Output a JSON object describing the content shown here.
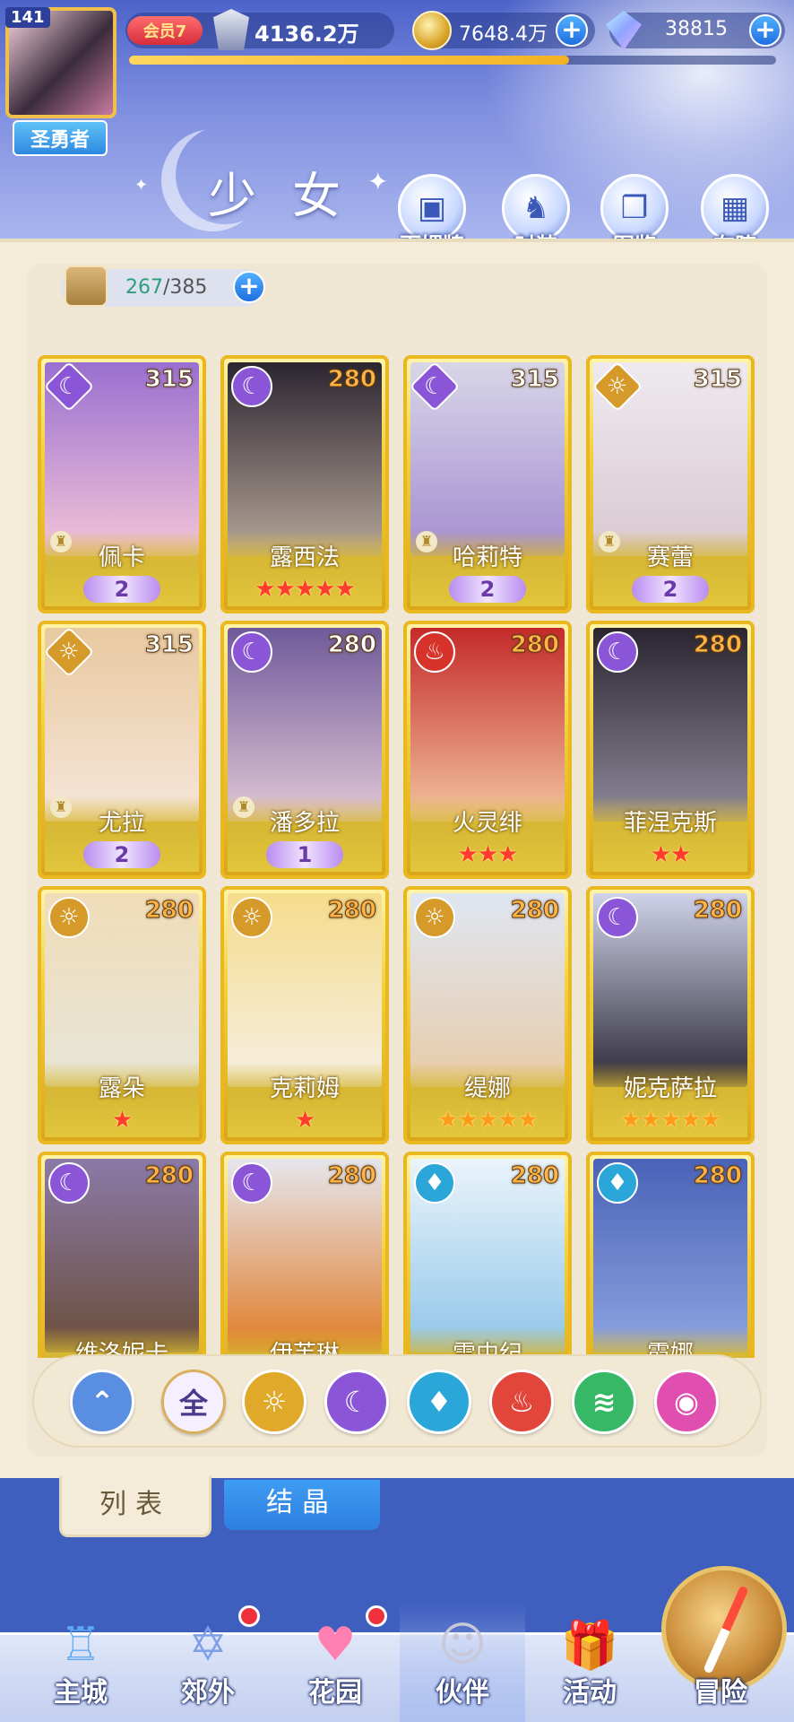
{
  "player": {
    "level": "141",
    "title": "圣勇者",
    "vip": "会员7",
    "power": "4136.2万",
    "gold": "7648.4万",
    "gems": "38815",
    "exp_fraction": 0.68
  },
  "header": {
    "page_title": "少女",
    "menu": [
      {
        "label": "百媚牌",
        "icon": "card-deck-icon"
      },
      {
        "label": "时装",
        "icon": "outfit-icon"
      },
      {
        "label": "图鉴",
        "icon": "book-icon"
      },
      {
        "label": "布阵",
        "icon": "formation-grid-icon"
      }
    ]
  },
  "collection": {
    "current": "267",
    "separator": "/",
    "total": "385"
  },
  "cards": [
    {
      "name": "佩卡",
      "level": "315",
      "element": "moon",
      "frame": "diamond",
      "awaken": "2",
      "stars": 0,
      "level_color": "white",
      "colors": [
        "#9a6fd0",
        "#f4c6d8"
      ]
    },
    {
      "name": "露西法",
      "level": "280",
      "element": "moon",
      "frame": "circle",
      "awaken": "",
      "stars": 5,
      "level_color": "orange",
      "colors": [
        "#2b2530",
        "#b7a79a"
      ]
    },
    {
      "name": "哈莉特",
      "level": "315",
      "element": "moon",
      "frame": "diamond",
      "awaken": "2",
      "stars": 0,
      "level_color": "white",
      "colors": [
        "#d8d6e8",
        "#a38cd0"
      ]
    },
    {
      "name": "赛蕾",
      "level": "315",
      "element": "sun",
      "frame": "diamond",
      "awaken": "2",
      "stars": 0,
      "level_color": "white",
      "colors": [
        "#eeeaf0",
        "#d9c8d0"
      ]
    },
    {
      "name": "尤拉",
      "level": "315",
      "element": "sun",
      "frame": "diamond",
      "awaken": "2",
      "stars": 0,
      "level_color": "white",
      "colors": [
        "#e8c9a0",
        "#f6e6da"
      ]
    },
    {
      "name": "潘多拉",
      "level": "280",
      "element": "moon",
      "frame": "circle",
      "awaken": "1",
      "stars": 0,
      "level_color": "white",
      "colors": [
        "#6f5a9a",
        "#e3c9d7"
      ]
    },
    {
      "name": "火灵绯",
      "level": "280",
      "element": "fire",
      "frame": "circle",
      "awaken": "",
      "stars": 3,
      "level_color": "orange",
      "colors": [
        "#c42a2a",
        "#f2c6a0"
      ]
    },
    {
      "name": "菲涅克斯",
      "level": "280",
      "element": "moon",
      "frame": "circle",
      "awaken": "",
      "stars": 2,
      "level_color": "orange",
      "colors": [
        "#2a2530",
        "#8f8a9a"
      ]
    },
    {
      "name": "露朵",
      "level": "280",
      "element": "sun",
      "frame": "circle",
      "awaken": "",
      "stars": 1,
      "level_color": "orange",
      "colors": [
        "#f1dcb8",
        "#e6e6d8"
      ]
    },
    {
      "name": "克莉姆",
      "level": "280",
      "element": "sun",
      "frame": "circle",
      "awaken": "",
      "stars": 1,
      "level_color": "orange",
      "colors": [
        "#f5dc8c",
        "#f6efe4"
      ]
    },
    {
      "name": "缇娜",
      "level": "280",
      "element": "sun",
      "frame": "circle",
      "awaken": "",
      "stars": 5,
      "level_color": "orange",
      "gold_stars": true,
      "colors": [
        "#dfe6f2",
        "#e8cba8"
      ]
    },
    {
      "name": "妮克萨拉",
      "level": "280",
      "element": "moon",
      "frame": "circle",
      "awaken": "",
      "stars": 5,
      "level_color": "orange",
      "gold_stars": true,
      "colors": [
        "#cfd2ea",
        "#2a2733"
      ]
    },
    {
      "name": "维洛妮卡",
      "level": "280",
      "element": "moon",
      "frame": "circle",
      "awaken": "",
      "stars": 0,
      "level_color": "orange",
      "colors": [
        "#8b7aa8",
        "#6b4e3a"
      ]
    },
    {
      "name": "伊芙琳",
      "level": "280",
      "element": "moon",
      "frame": "circle",
      "awaken": "",
      "stars": 0,
      "level_color": "orange",
      "colors": [
        "#e6e6ee",
        "#e07a24"
      ]
    },
    {
      "name": "雪中纪",
      "level": "280",
      "element": "water",
      "frame": "circle",
      "awaken": "",
      "stars": 0,
      "level_color": "orange",
      "colors": [
        "#eaf4fb",
        "#8fc5e8"
      ]
    },
    {
      "name": "霞娜",
      "level": "280",
      "element": "water",
      "frame": "circle",
      "awaken": "",
      "stars": 0,
      "level_color": "orange",
      "colors": [
        "#4a62b8",
        "#8fa4e0"
      ]
    }
  ],
  "filters": [
    {
      "label": "",
      "icon": "collapse-up-icon",
      "color": "#5a8ee0"
    },
    {
      "label": "全",
      "icon": "all-filter",
      "color": "#f4f0ff"
    },
    {
      "label": "",
      "icon": "sun-element-icon",
      "color": "#e0a92a"
    },
    {
      "label": "",
      "icon": "moon-element-icon",
      "color": "#8a55d6"
    },
    {
      "label": "",
      "icon": "water-element-icon",
      "color": "#2aa6d8"
    },
    {
      "label": "",
      "icon": "fire-element-icon",
      "color": "#e2453a"
    },
    {
      "label": "",
      "icon": "wind-element-icon",
      "color": "#36b867"
    },
    {
      "label": "",
      "icon": "dark-element-icon",
      "color": "#e04fb0"
    }
  ],
  "tabs": {
    "list": "列表",
    "crystal": "结晶"
  },
  "bottom_nav": [
    {
      "label": "主城",
      "icon": "castle-icon",
      "dot": false
    },
    {
      "label": "郊外",
      "icon": "outskirts-icon",
      "dot": true
    },
    {
      "label": "花园",
      "icon": "garden-heart-icon",
      "dot": true
    },
    {
      "label": "伙伴",
      "icon": "partner-icon",
      "dot": false,
      "active": true
    },
    {
      "label": "活动",
      "icon": "gift-box-icon",
      "dot": false
    },
    {
      "label": "冒险",
      "icon": "compass-icon",
      "dot": false
    }
  ],
  "element_colors": {
    "moon": "#8a55d6",
    "sun": "#d69a2a",
    "fire": "#d8332b",
    "water": "#2aa6d8"
  },
  "element_glyphs": {
    "moon": "☾",
    "sun": "☼",
    "fire": "♨",
    "water": "♦"
  }
}
